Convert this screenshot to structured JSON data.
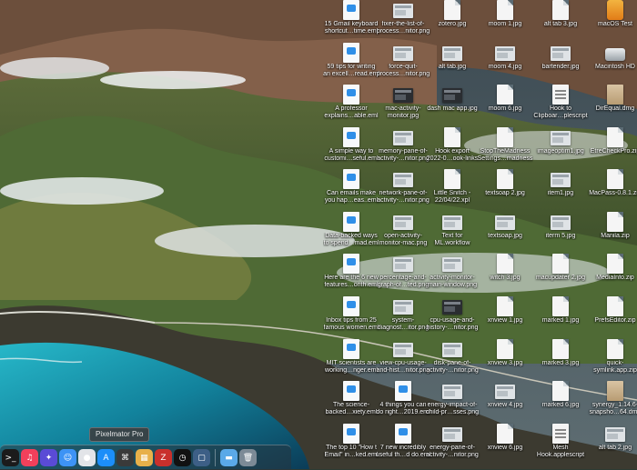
{
  "colors": {
    "accent": "#2f8fe8"
  },
  "tooltip": "Pixelmator Pro",
  "columns": [
    {
      "items": [
        {
          "label": "15 Gmail keyboard",
          "label2": "shortcut…time.eml",
          "icon": "email"
        },
        {
          "label": "59 tips for writing",
          "label2": "an excell…read.eml",
          "icon": "email"
        },
        {
          "label": "A professor",
          "label2": "explains…able.eml",
          "icon": "email"
        },
        {
          "label": "A simple way to",
          "label2": "customi…seful.eml",
          "icon": "email"
        },
        {
          "label": "Can emails make",
          "label2": "you hap…eas..eml",
          "icon": "email"
        },
        {
          "label": "Data-backed ways",
          "label2": "to spend…mad.eml",
          "icon": "email"
        },
        {
          "label": "Here are the 6 new",
          "label2": "features…onth.eml",
          "icon": "email"
        },
        {
          "label": "Inbox tips from 25",
          "label2": "famous women.eml",
          "icon": "email"
        },
        {
          "label": "MIT scientists are",
          "label2": "working…nger.eml",
          "icon": "email"
        },
        {
          "label": "The science-",
          "label2": "backed…xiety.eml",
          "icon": "email"
        },
        {
          "label": "The top 10 \"How t",
          "label2": "Email\" in…ked.eml",
          "icon": "email"
        }
      ]
    },
    {
      "items": [
        {
          "label": "fixer-the-list-of-",
          "label2": "process…nitor.png",
          "icon": "shot"
        },
        {
          "label": "force-quit-",
          "label2": "process…nitor.png",
          "icon": "shot"
        },
        {
          "label": "mac-activity-",
          "label2": "monitor.jpg",
          "icon": "shot-dark"
        },
        {
          "label": "memory-pane-of-",
          "label2": "activity-…nitor.png",
          "icon": "shot"
        },
        {
          "label": "network-pane-of-",
          "label2": "activity-…nitor.png",
          "icon": "shot"
        },
        {
          "label": "open-activity-",
          "label2": "monitor-mac.png",
          "icon": "shot"
        },
        {
          "label": "percentage-and-",
          "label2": "graph-of…ted.png",
          "icon": "shot"
        },
        {
          "label": "system-",
          "label2": "diagnost…itor.png",
          "icon": "shot"
        },
        {
          "label": "view-cpu-usage-",
          "label2": "and-hist…nitor.png",
          "icon": "shot"
        },
        {
          "label": "4 things you can",
          "label2": "do right…2019.eml",
          "icon": "email"
        },
        {
          "label": "7 new incredibly",
          "label2": "useful th…d do.eml",
          "icon": "email"
        }
      ]
    },
    {
      "items": [
        {
          "label": "zotero.jpg",
          "label2": "",
          "icon": "doc"
        },
        {
          "label": "alt tab.jpg",
          "label2": "",
          "icon": "shot"
        },
        {
          "label": "dash mac app.jpg",
          "label2": "",
          "icon": "shot-dark"
        },
        {
          "label": "Hook export",
          "label2": "2022-0…ook-links",
          "icon": "doc"
        },
        {
          "label": "Little Snitch -",
          "label2": "22/04/22.xpl",
          "icon": "doc"
        },
        {
          "label": "Text for",
          "label2": "ML.workflow",
          "icon": "shot"
        },
        {
          "label": "activity-monitor-",
          "label2": "main-window.png",
          "icon": "shot"
        },
        {
          "label": "cpu-usage-and-",
          "label2": "history-…nitor.png",
          "icon": "shot-dark"
        },
        {
          "label": "disk-pane-of-",
          "label2": "activity-…nitor.png",
          "icon": "shot"
        },
        {
          "label": "energy-impact-of-",
          "label2": "child-pr…sses.png",
          "icon": "shot"
        },
        {
          "label": "energy-pane-of-",
          "label2": "activity-…nitor.png",
          "icon": "shot"
        }
      ]
    },
    {
      "items": [
        {
          "label": "moom 1.jpg",
          "label2": "",
          "icon": "doc"
        },
        {
          "label": "moom 4.jpg",
          "label2": "",
          "icon": "shot"
        },
        {
          "label": "moom 6.jpg",
          "label2": "",
          "icon": "doc"
        },
        {
          "label": "StopTheMadness",
          "label2": "Settings…madness",
          "icon": "doc"
        },
        {
          "label": "textsoap 2.jpg",
          "label2": "",
          "icon": "doc"
        },
        {
          "label": "textsoap.jpg",
          "label2": "",
          "icon": "shot"
        },
        {
          "label": "witch 3.jpg",
          "label2": "",
          "icon": "doc"
        },
        {
          "label": "xnview 1.jpg",
          "label2": "",
          "icon": "doc"
        },
        {
          "label": "xnview 3.jpg",
          "label2": "",
          "icon": "doc"
        },
        {
          "label": "xnview 4.jpg",
          "label2": "",
          "icon": "shot"
        },
        {
          "label": "xnview 6.jpg",
          "label2": "",
          "icon": "doc"
        }
      ]
    },
    {
      "items": [
        {
          "label": "alt tab 3.jpg",
          "label2": "",
          "icon": "doc"
        },
        {
          "label": "bartender.jpg",
          "label2": "",
          "icon": "shot"
        },
        {
          "label": "Hook to",
          "label2": "Clipboar…plescript",
          "icon": "script"
        },
        {
          "label": "imageoptim1.jpg",
          "label2": "",
          "icon": "shot"
        },
        {
          "label": "item1.jpg",
          "label2": "",
          "icon": "shot"
        },
        {
          "label": "iterm 5.jpg",
          "label2": "",
          "icon": "shot"
        },
        {
          "label": "macupdater 2.jpg",
          "label2": "",
          "icon": "doc"
        },
        {
          "label": "marked 1.jpg",
          "label2": "",
          "icon": "doc"
        },
        {
          "label": "marked 3.jpg",
          "label2": "",
          "icon": "doc"
        },
        {
          "label": "marked 6.jpg",
          "label2": "",
          "icon": "doc"
        },
        {
          "label": "Mesh",
          "label2": "Hook.applescript",
          "icon": "script"
        }
      ]
    },
    {
      "items": [
        {
          "label": "macOS Test",
          "label2": "",
          "icon": "installer"
        },
        {
          "label": "Macintosh HD",
          "label2": "",
          "icon": "drive"
        },
        {
          "label": "DirEqual.dmg",
          "label2": "",
          "icon": "pkg"
        },
        {
          "label": "EtreCheckPro.zip",
          "label2": "",
          "icon": "doc"
        },
        {
          "label": "MacPass-0.8.1.zip",
          "label2": "",
          "icon": "doc"
        },
        {
          "label": "Manila.zip",
          "label2": "",
          "icon": "doc"
        },
        {
          "label": "MediaInfo.zip",
          "label2": "",
          "icon": "doc"
        },
        {
          "label": "PrefsEditor.zip",
          "label2": "",
          "icon": "doc"
        },
        {
          "label": "quick-",
          "label2": "symlink.app.zip",
          "icon": "doc"
        },
        {
          "label": "synergy_1.14.6-",
          "label2": "snapsho…64.dmg",
          "icon": "pkg"
        },
        {
          "label": "alt tab 2.jpg",
          "label2": "",
          "icon": "shot"
        }
      ]
    }
  ],
  "dock": [
    {
      "name": "terminal-icon",
      "glyph": ">_",
      "color": "#1b1b1b"
    },
    {
      "name": "music-icon",
      "glyph": "♫",
      "color": "#f2405b"
    },
    {
      "name": "launchpad-icon",
      "glyph": "✦",
      "color": "#5a4bd6"
    },
    {
      "name": "finder-icon",
      "glyph": "☺",
      "color": "#3d93f5"
    },
    {
      "name": "pixelmator-icon",
      "glyph": "●",
      "color": "#e2e4e8"
    },
    {
      "name": "app-store-icon",
      "glyph": "A",
      "color": "#1c8ef9"
    },
    {
      "name": "keyboard-maestro-icon",
      "glyph": "⌘",
      "color": "#3a3a3a"
    },
    {
      "name": "photo-app-icon",
      "glyph": "▦",
      "color": "#e8b04a"
    },
    {
      "name": "archiver-icon",
      "glyph": "Z",
      "color": "#c9302c"
    },
    {
      "name": "clock-icon",
      "glyph": "◷",
      "color": "#111111"
    },
    {
      "name": "screenshot-app-icon",
      "glyph": "▢",
      "color": "#3d5f86"
    },
    {
      "name": "folder-icon",
      "glyph": "▬",
      "color": "#5aa9e8"
    },
    {
      "name": "trash-icon",
      "glyph": "🗑",
      "color": "#7c8a96"
    }
  ]
}
